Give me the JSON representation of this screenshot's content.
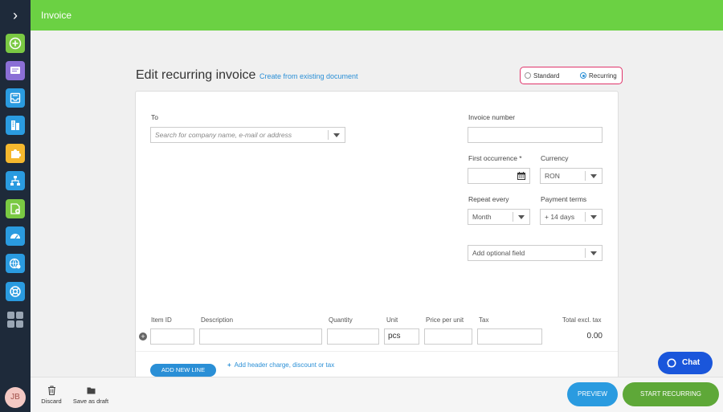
{
  "header": {
    "title": "Invoice"
  },
  "page": {
    "title": "Edit recurring invoice",
    "create_link": "Create from existing document"
  },
  "type_toggle": {
    "standard": "Standard",
    "recurring": "Recurring",
    "selected": "recurring"
  },
  "form": {
    "to_label": "To",
    "to_placeholder": "Search for company name, e-mail or address",
    "invoice_number_label": "Invoice number",
    "invoice_number_value": "",
    "first_occurrence_label": "First occurrence *",
    "currency_label": "Currency",
    "currency_value": "RON",
    "repeat_every_label": "Repeat every",
    "repeat_every_value": "Month",
    "payment_terms_label": "Payment terms",
    "payment_terms_value": "+ 14 days",
    "optional_field": "Add optional field"
  },
  "lines": {
    "columns": [
      "Item ID",
      "Description",
      "Quantity",
      "Unit",
      "Price per unit",
      "Tax",
      "Total excl. tax"
    ],
    "row": {
      "item_id": "",
      "description": "",
      "quantity": "",
      "unit": "pcs",
      "price": "",
      "tax": "",
      "total": "0.00"
    },
    "add_line": "ADD NEW LINE",
    "add_header": "Add header charge, discount or tax"
  },
  "footer": {
    "discard": "Discard",
    "save_draft": "Save as draft",
    "preview": "PREVIEW",
    "start": "START RECURRING"
  },
  "chat": {
    "label": "Chat"
  },
  "user": {
    "initials": "JB"
  },
  "colors": {
    "brand_green": "#6bd143",
    "accent_blue": "#2a8fd6",
    "sidebar": "#1e2a3a",
    "toggle_border": "#e0346a"
  }
}
